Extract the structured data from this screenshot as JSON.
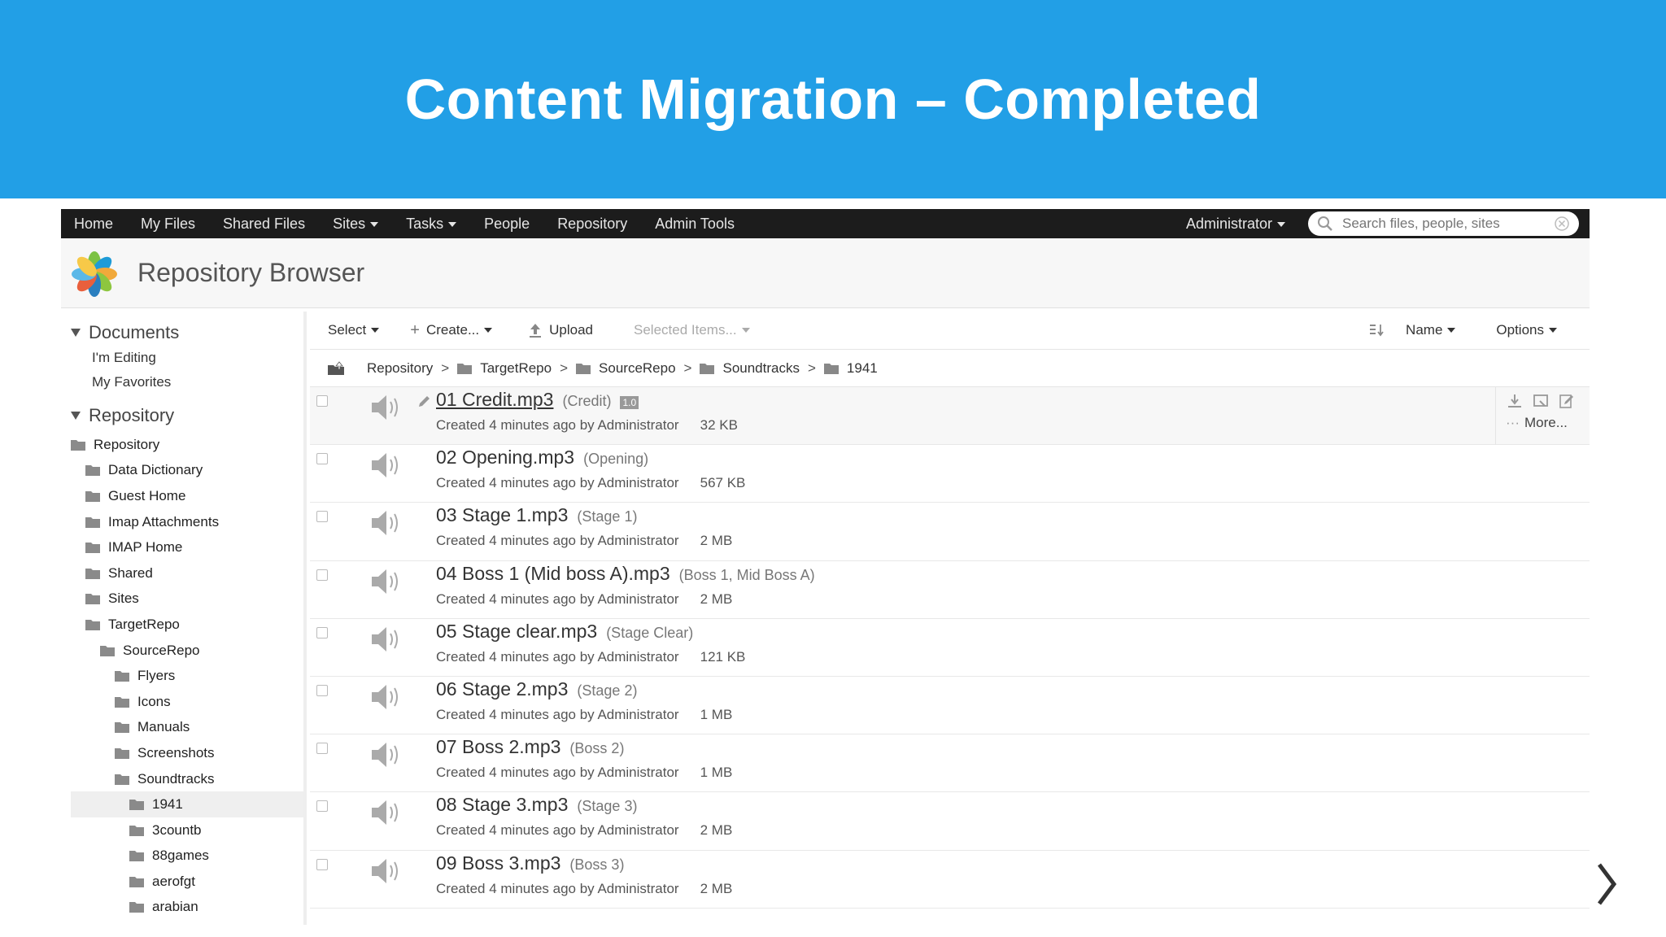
{
  "banner": {
    "title": "Content Migration – Completed"
  },
  "nav": {
    "items": [
      "Home",
      "My Files",
      "Shared Files",
      "Sites",
      "Tasks",
      "People",
      "Repository",
      "Admin Tools"
    ],
    "user": "Administrator",
    "search_placeholder": "Search files, people, sites"
  },
  "header": {
    "title": "Repository Browser"
  },
  "sidebar": {
    "documents_label": "Documents",
    "documents_links": [
      "I'm Editing",
      "My Favorites"
    ],
    "repository_label": "Repository",
    "tree": [
      {
        "label": "Repository",
        "depth": 0
      },
      {
        "label": "Data Dictionary",
        "depth": 1
      },
      {
        "label": "Guest Home",
        "depth": 1
      },
      {
        "label": "Imap Attachments",
        "depth": 1
      },
      {
        "label": "IMAP Home",
        "depth": 1
      },
      {
        "label": "Shared",
        "depth": 1
      },
      {
        "label": "Sites",
        "depth": 1
      },
      {
        "label": "TargetRepo",
        "depth": 1
      },
      {
        "label": "SourceRepo",
        "depth": 2
      },
      {
        "label": "Flyers",
        "depth": 3
      },
      {
        "label": "Icons",
        "depth": 3
      },
      {
        "label": "Manuals",
        "depth": 3
      },
      {
        "label": "Screenshots",
        "depth": 3
      },
      {
        "label": "Soundtracks",
        "depth": 3
      },
      {
        "label": "1941",
        "depth": 4,
        "selected": true
      },
      {
        "label": "3countb",
        "depth": 4
      },
      {
        "label": "88games",
        "depth": 4
      },
      {
        "label": "aerofgt",
        "depth": 4
      },
      {
        "label": "arabian",
        "depth": 4
      }
    ]
  },
  "toolbar": {
    "select": "Select",
    "create": "Create...",
    "upload": "Upload",
    "selected_items": "Selected Items...",
    "sort": "Name",
    "options": "Options"
  },
  "breadcrumb": [
    "Repository",
    "TargetRepo",
    "SourceRepo",
    "Soundtracks",
    "1941"
  ],
  "files": [
    {
      "name": "01 Credit.mp3",
      "title": "(Credit)",
      "version": "1.0",
      "meta": "Created 4 minutes ago by Administrator",
      "size": "32 KB"
    },
    {
      "name": "02 Opening.mp3",
      "title": "(Opening)",
      "meta": "Created 4 minutes ago by Administrator",
      "size": "567 KB"
    },
    {
      "name": "03 Stage 1.mp3",
      "title": "(Stage 1)",
      "meta": "Created 4 minutes ago by Administrator",
      "size": "2 MB"
    },
    {
      "name": "04 Boss 1 (Mid boss A).mp3",
      "title": "(Boss 1, Mid Boss A)",
      "meta": "Created 4 minutes ago by Administrator",
      "size": "2 MB"
    },
    {
      "name": "05 Stage clear.mp3",
      "title": "(Stage Clear)",
      "meta": "Created 4 minutes ago by Administrator",
      "size": "121 KB"
    },
    {
      "name": "06 Stage 2.mp3",
      "title": "(Stage 2)",
      "meta": "Created 4 minutes ago by Administrator",
      "size": "1 MB"
    },
    {
      "name": "07 Boss 2.mp3",
      "title": "(Boss 2)",
      "meta": "Created 4 minutes ago by Administrator",
      "size": "1 MB"
    },
    {
      "name": "08 Stage 3.mp3",
      "title": "(Stage 3)",
      "meta": "Created 4 minutes ago by Administrator",
      "size": "2 MB"
    },
    {
      "name": "09 Boss 3.mp3",
      "title": "(Boss 3)",
      "meta": "Created 4 minutes ago by Administrator",
      "size": "2 MB"
    }
  ],
  "row_actions": {
    "more": "More..."
  },
  "colors": {
    "banner": "#229fe6",
    "navbar": "#1c1c1c"
  }
}
